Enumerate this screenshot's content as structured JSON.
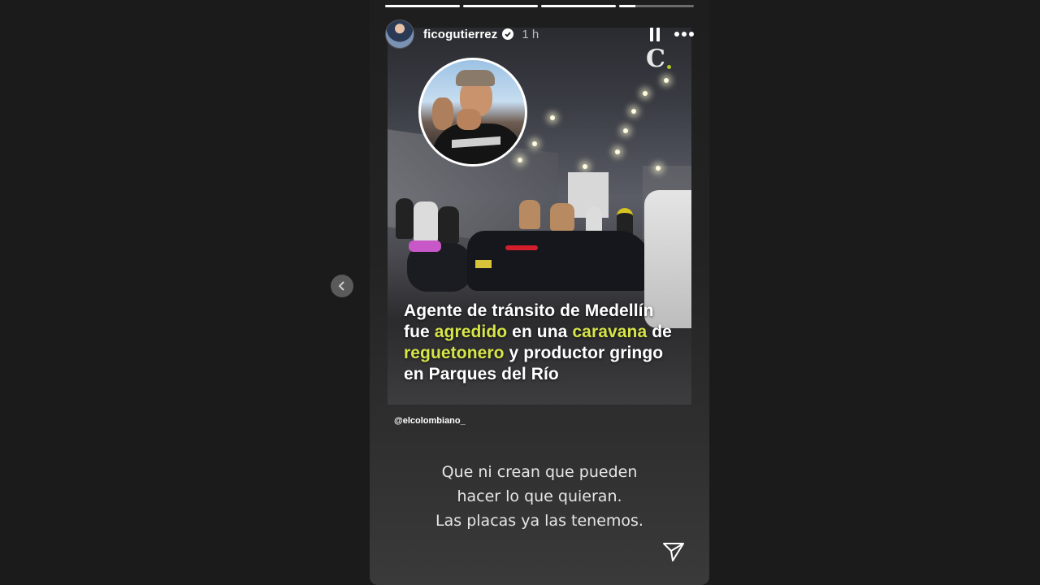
{
  "story": {
    "progress": [
      1,
      1,
      1,
      0.22
    ],
    "user": {
      "username": "ficogutierrez",
      "time_ago": "1 h",
      "verified": true
    },
    "post": {
      "headline_parts": [
        {
          "text": "Agente de tránsito de Medellín ",
          "highlight": false
        },
        {
          "text": "fue ",
          "highlight": false
        },
        {
          "text": "agredido",
          "highlight": true
        },
        {
          "text": " en una ",
          "highlight": false
        },
        {
          "text": "caravana",
          "highlight": true
        },
        {
          "text": " de ",
          "highlight": false
        },
        {
          "text": "reguetonero",
          "highlight": true
        },
        {
          "text": " y productor gringo en Parques del Río",
          "highlight": false
        }
      ],
      "source_logo": "C",
      "mention": "@elcolombiano_"
    },
    "caption_lines": [
      "Que ni crean que pueden",
      "hacer lo que quieran.",
      "Las placas ya las tenemos."
    ],
    "icons": {
      "pause": "pause-icon",
      "more": "more-options-icon",
      "send": "send-icon",
      "prev": "chevron-left-icon",
      "verified": "verified-badge-icon"
    },
    "colors": {
      "highlight": "#d7e548",
      "background": "#1b1b1b"
    }
  }
}
